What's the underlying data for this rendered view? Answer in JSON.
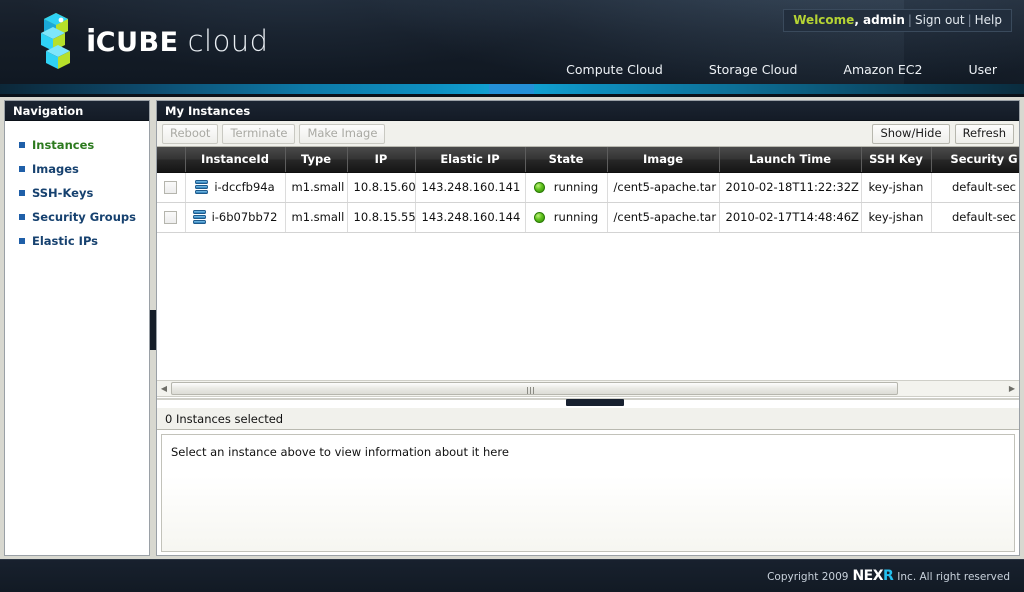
{
  "header": {
    "logo": {
      "brand_i": "i",
      "brand_cube": "CUBE",
      "brand_cloud": "cloud"
    },
    "welcome": {
      "welcome_word": "Welcome",
      "user": ", admin",
      "sign_out": "Sign out",
      "help": "Help",
      "separator": "|"
    },
    "nav": [
      {
        "label": "Compute Cloud"
      },
      {
        "label": "Storage Cloud"
      },
      {
        "label": "Amazon EC2"
      },
      {
        "label": "User"
      }
    ],
    "accent_green": "#b5d334",
    "accent_blue": "#12a5d6"
  },
  "sidebar": {
    "title": "Navigation",
    "items": [
      {
        "label": "Instances",
        "active": true
      },
      {
        "label": "Images",
        "active": false
      },
      {
        "label": "SSH-Keys",
        "active": false
      },
      {
        "label": "Security Groups",
        "active": false
      },
      {
        "label": "Elastic IPs",
        "active": false
      }
    ]
  },
  "main": {
    "title": "My Instances",
    "toolbar": {
      "reboot": "Reboot",
      "terminate": "Terminate",
      "make_image": "Make Image",
      "show_hide": "Show/Hide",
      "refresh": "Refresh"
    },
    "table": {
      "columns": [
        "",
        "InstanceId",
        "Type",
        "IP",
        "Elastic IP",
        "State",
        "Image",
        "Launch Time",
        "SSH Key",
        "Security G"
      ],
      "rows": [
        {
          "checked": false,
          "instance_id": "i-dccfb94a",
          "type": "m1.small",
          "ip": "10.8.15.60",
          "elastic_ip": "143.248.160.141",
          "state": "running",
          "image": "/cent5-apache.tar",
          "launch_time": "2010-02-18T11:22:32Z",
          "ssh_key": "key-jshan",
          "security_group": "default-sec"
        },
        {
          "checked": false,
          "instance_id": "i-6b07bb72",
          "type": "m1.small",
          "ip": "10.8.15.55",
          "elastic_ip": "143.248.160.144",
          "state": "running",
          "image": "/cent5-apache.tar",
          "launch_time": "2010-02-17T14:48:46Z",
          "ssh_key": "key-jshan",
          "security_group": "default-sec"
        }
      ]
    },
    "selection_status": "0 Instances selected",
    "detail_placeholder": "Select an instance above to view information about it here"
  },
  "footer": {
    "copyright_prefix": "Copyright 2009",
    "company_nex": "NEX",
    "company_r": "R",
    "copyright_suffix": "Inc. All right reserved"
  }
}
